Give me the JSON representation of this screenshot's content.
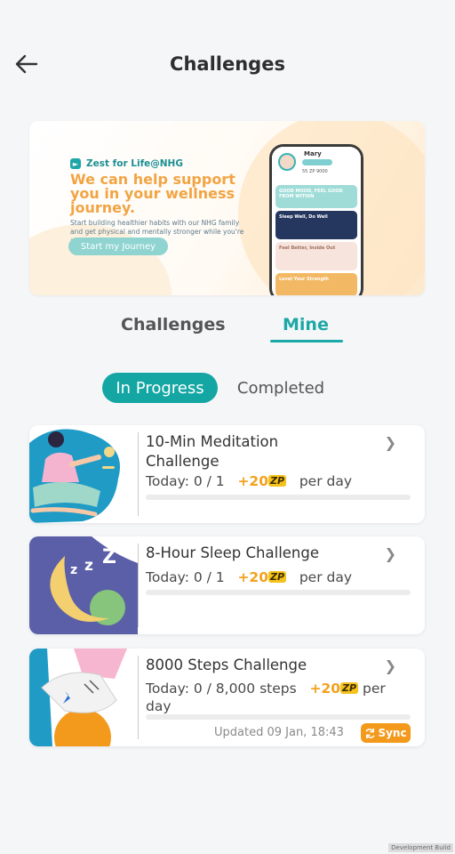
{
  "header": {
    "back_icon": "arrow-left-icon",
    "title": "Challenges"
  },
  "banner": {
    "brand": "Zest for Life@NHG",
    "headline": "We can help support you in your wellness journey.",
    "subtext": "Start building healthier habits with our NHG family and get physical and mentally stronger while you're at it!",
    "cta_label": "Start my Journey",
    "phone": {
      "name": "Mary",
      "stats": "55 ZP 9000",
      "cards": [
        "GOOD MOOD, FEEL GOOD FROM WITHIN",
        "Sleep Well, Do Well",
        "Feel Better, Inside Out",
        "Level Your Strength"
      ]
    }
  },
  "tabs": {
    "challenges": "Challenges",
    "mine": "Mine",
    "active": "mine"
  },
  "filters": {
    "in_progress": "In Progress",
    "completed": "Completed"
  },
  "challenges": [
    {
      "title": "10-Min Meditation Challenge",
      "today": "Today: 0 / 1",
      "points": "+20",
      "badge": "ZP",
      "per": "per day",
      "progress": 0
    },
    {
      "title": "8-Hour Sleep Challenge",
      "today": "Today: 0 / 1",
      "points": "+20",
      "badge": "ZP",
      "per": "per day",
      "progress": 0
    },
    {
      "title": "8000 Steps Challenge",
      "today": "Today: 0 / 8,000 steps",
      "points": "+20",
      "badge": "ZP",
      "per": "per day",
      "progress": 0,
      "updated": "Updated 09 Jan, 18:43",
      "sync_label": "Sync"
    }
  ],
  "colors": {
    "accent": "#13a6a3",
    "points": "#f2a21f",
    "sync": "#f39a1d"
  },
  "footer": "Development Build"
}
